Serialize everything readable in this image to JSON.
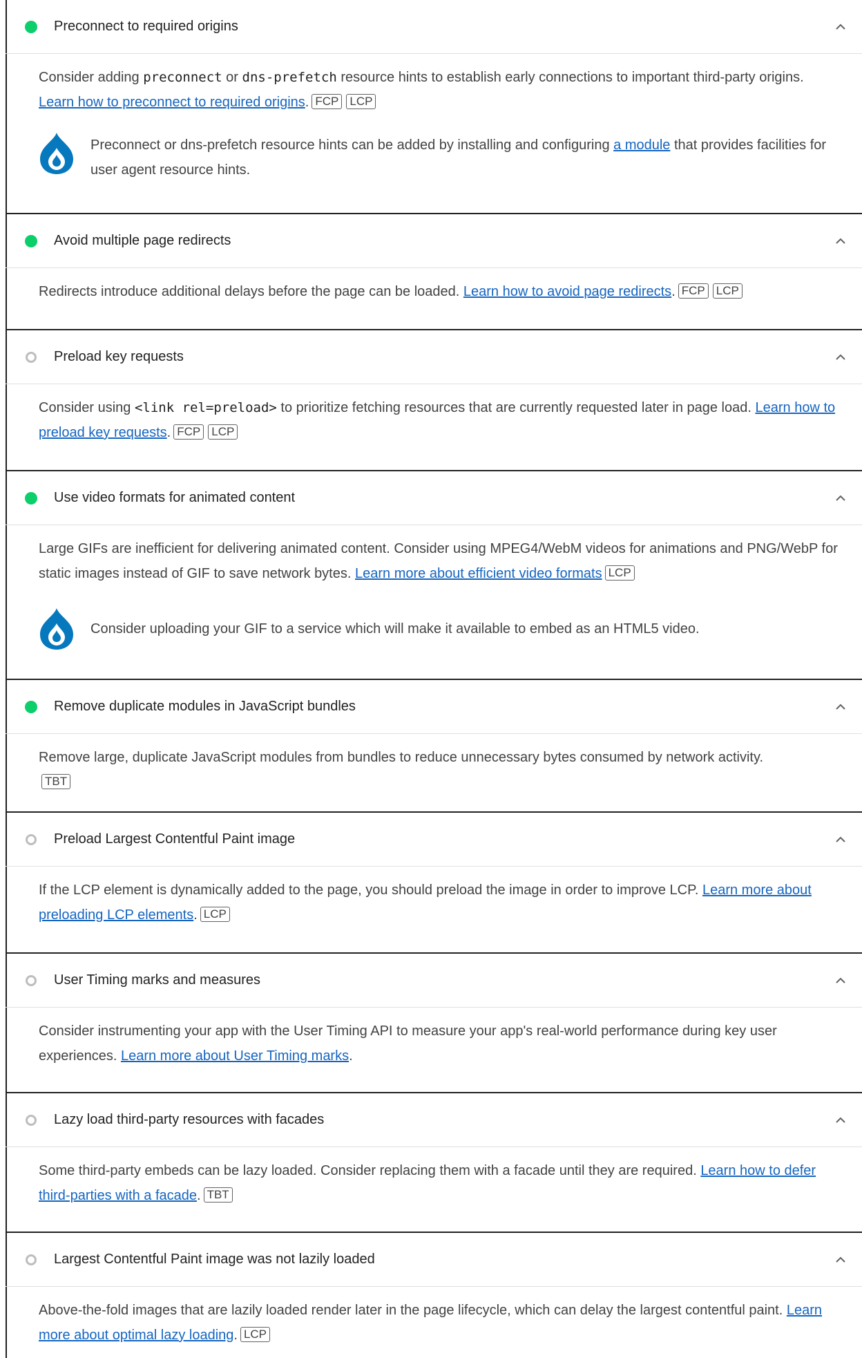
{
  "colors": {
    "pass": "#0cce6b",
    "info_ring": "#bdbdbd",
    "link": "#1565c0",
    "drupal": "#0678be"
  },
  "audits": [
    {
      "status": "pass",
      "title": "Preconnect to required origins",
      "desc_a": "Consider adding ",
      "code_1": "preconnect",
      "desc_b": " or ",
      "code_2": "dns-prefetch",
      "desc_c": " resource hints to establish early connections to important third-party origins. ",
      "link": "Learn how to preconnect to required origins",
      "after_link": ".",
      "tags": [
        "FCP",
        "LCP"
      ],
      "stack_icon": "drupal-icon",
      "stack_a": "Preconnect or dns-prefetch resource hints can be added by installing and configuring ",
      "stack_link": "a module",
      "stack_b": " that provides facilities for user agent resource hints."
    },
    {
      "status": "pass",
      "title": "Avoid multiple page redirects",
      "desc": "Redirects introduce additional delays before the page can be loaded. ",
      "link": "Learn how to avoid page redirects",
      "after_link": ".",
      "tags": [
        "FCP",
        "LCP"
      ]
    },
    {
      "status": "info",
      "title": "Preload key requests",
      "desc_a": "Consider using ",
      "code_1": "<link rel=preload>",
      "desc_b": " to prioritize fetching resources that are currently requested later in page load. ",
      "link": "Learn how to preload key requests",
      "after_link": ".",
      "tags": [
        "FCP",
        "LCP"
      ]
    },
    {
      "status": "pass",
      "title": "Use video formats for animated content",
      "desc": "Large GIFs are inefficient for delivering animated content. Consider using MPEG4/WebM videos for animations and PNG/WebP for static images instead of GIF to save network bytes. ",
      "link": "Learn more about efficient video formats",
      "after_link": "",
      "tags": [
        "LCP"
      ],
      "stack_icon": "drupal-icon",
      "stack_text": "Consider uploading your GIF to a service which will make it available to embed as an HTML5 video."
    },
    {
      "status": "pass",
      "title": "Remove duplicate modules in JavaScript bundles",
      "desc": "Remove large, duplicate JavaScript modules from bundles to reduce unnecessary bytes consumed by network activity.",
      "tags": [
        "TBT"
      ]
    },
    {
      "status": "info",
      "title": "Preload Largest Contentful Paint image",
      "desc": "If the LCP element is dynamically added to the page, you should preload the image in order to improve LCP. ",
      "link": "Learn more about preloading LCP elements",
      "after_link": ".",
      "tags": [
        "LCP"
      ]
    },
    {
      "status": "info",
      "title": "User Timing marks and measures",
      "desc": "Consider instrumenting your app with the User Timing API to measure your app's real-world performance during key user experiences. ",
      "link": "Learn more about User Timing marks",
      "after_link": "."
    },
    {
      "status": "info",
      "title": "Lazy load third-party resources with facades",
      "desc": "Some third-party embeds can be lazy loaded. Consider replacing them with a facade until they are required. ",
      "link": "Learn how to defer third-parties with a facade",
      "after_link": ".",
      "tags": [
        "TBT"
      ]
    },
    {
      "status": "info",
      "title": "Largest Contentful Paint image was not lazily loaded",
      "desc": "Above-the-fold images that are lazily loaded render later in the page lifecycle, which can delay the largest contentful paint. ",
      "link": "Learn more about optimal lazy loading",
      "after_link": ".",
      "tags": [
        "LCP"
      ]
    }
  ]
}
